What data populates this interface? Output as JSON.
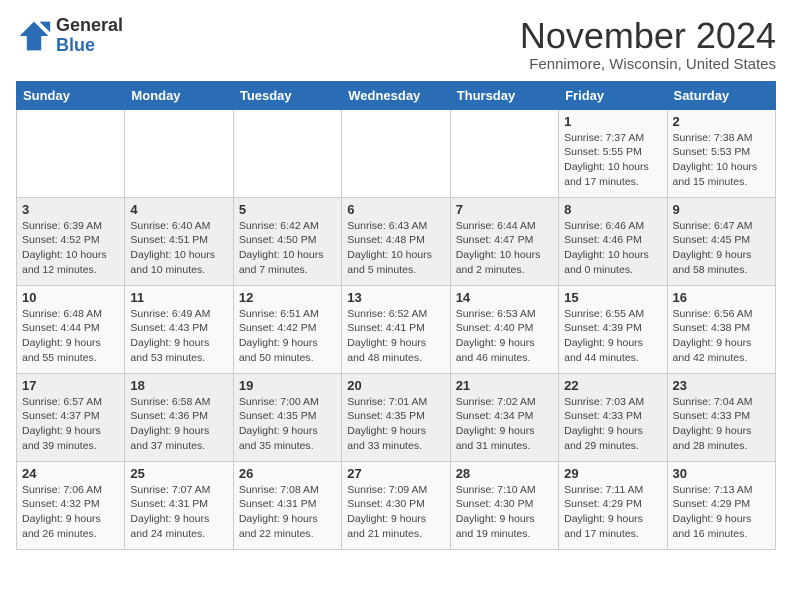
{
  "header": {
    "logo_line1": "General",
    "logo_line2": "Blue",
    "month_year": "November 2024",
    "location": "Fennimore, Wisconsin, United States"
  },
  "weekdays": [
    "Sunday",
    "Monday",
    "Tuesday",
    "Wednesday",
    "Thursday",
    "Friday",
    "Saturday"
  ],
  "weeks": [
    [
      {
        "day": "",
        "detail": ""
      },
      {
        "day": "",
        "detail": ""
      },
      {
        "day": "",
        "detail": ""
      },
      {
        "day": "",
        "detail": ""
      },
      {
        "day": "",
        "detail": ""
      },
      {
        "day": "1",
        "detail": "Sunrise: 7:37 AM\nSunset: 5:55 PM\nDaylight: 10 hours and 17 minutes."
      },
      {
        "day": "2",
        "detail": "Sunrise: 7:38 AM\nSunset: 5:53 PM\nDaylight: 10 hours and 15 minutes."
      }
    ],
    [
      {
        "day": "3",
        "detail": "Sunrise: 6:39 AM\nSunset: 4:52 PM\nDaylight: 10 hours and 12 minutes."
      },
      {
        "day": "4",
        "detail": "Sunrise: 6:40 AM\nSunset: 4:51 PM\nDaylight: 10 hours and 10 minutes."
      },
      {
        "day": "5",
        "detail": "Sunrise: 6:42 AM\nSunset: 4:50 PM\nDaylight: 10 hours and 7 minutes."
      },
      {
        "day": "6",
        "detail": "Sunrise: 6:43 AM\nSunset: 4:48 PM\nDaylight: 10 hours and 5 minutes."
      },
      {
        "day": "7",
        "detail": "Sunrise: 6:44 AM\nSunset: 4:47 PM\nDaylight: 10 hours and 2 minutes."
      },
      {
        "day": "8",
        "detail": "Sunrise: 6:46 AM\nSunset: 4:46 PM\nDaylight: 10 hours and 0 minutes."
      },
      {
        "day": "9",
        "detail": "Sunrise: 6:47 AM\nSunset: 4:45 PM\nDaylight: 9 hours and 58 minutes."
      }
    ],
    [
      {
        "day": "10",
        "detail": "Sunrise: 6:48 AM\nSunset: 4:44 PM\nDaylight: 9 hours and 55 minutes."
      },
      {
        "day": "11",
        "detail": "Sunrise: 6:49 AM\nSunset: 4:43 PM\nDaylight: 9 hours and 53 minutes."
      },
      {
        "day": "12",
        "detail": "Sunrise: 6:51 AM\nSunset: 4:42 PM\nDaylight: 9 hours and 50 minutes."
      },
      {
        "day": "13",
        "detail": "Sunrise: 6:52 AM\nSunset: 4:41 PM\nDaylight: 9 hours and 48 minutes."
      },
      {
        "day": "14",
        "detail": "Sunrise: 6:53 AM\nSunset: 4:40 PM\nDaylight: 9 hours and 46 minutes."
      },
      {
        "day": "15",
        "detail": "Sunrise: 6:55 AM\nSunset: 4:39 PM\nDaylight: 9 hours and 44 minutes."
      },
      {
        "day": "16",
        "detail": "Sunrise: 6:56 AM\nSunset: 4:38 PM\nDaylight: 9 hours and 42 minutes."
      }
    ],
    [
      {
        "day": "17",
        "detail": "Sunrise: 6:57 AM\nSunset: 4:37 PM\nDaylight: 9 hours and 39 minutes."
      },
      {
        "day": "18",
        "detail": "Sunrise: 6:58 AM\nSunset: 4:36 PM\nDaylight: 9 hours and 37 minutes."
      },
      {
        "day": "19",
        "detail": "Sunrise: 7:00 AM\nSunset: 4:35 PM\nDaylight: 9 hours and 35 minutes."
      },
      {
        "day": "20",
        "detail": "Sunrise: 7:01 AM\nSunset: 4:35 PM\nDaylight: 9 hours and 33 minutes."
      },
      {
        "day": "21",
        "detail": "Sunrise: 7:02 AM\nSunset: 4:34 PM\nDaylight: 9 hours and 31 minutes."
      },
      {
        "day": "22",
        "detail": "Sunrise: 7:03 AM\nSunset: 4:33 PM\nDaylight: 9 hours and 29 minutes."
      },
      {
        "day": "23",
        "detail": "Sunrise: 7:04 AM\nSunset: 4:33 PM\nDaylight: 9 hours and 28 minutes."
      }
    ],
    [
      {
        "day": "24",
        "detail": "Sunrise: 7:06 AM\nSunset: 4:32 PM\nDaylight: 9 hours and 26 minutes."
      },
      {
        "day": "25",
        "detail": "Sunrise: 7:07 AM\nSunset: 4:31 PM\nDaylight: 9 hours and 24 minutes."
      },
      {
        "day": "26",
        "detail": "Sunrise: 7:08 AM\nSunset: 4:31 PM\nDaylight: 9 hours and 22 minutes."
      },
      {
        "day": "27",
        "detail": "Sunrise: 7:09 AM\nSunset: 4:30 PM\nDaylight: 9 hours and 21 minutes."
      },
      {
        "day": "28",
        "detail": "Sunrise: 7:10 AM\nSunset: 4:30 PM\nDaylight: 9 hours and 19 minutes."
      },
      {
        "day": "29",
        "detail": "Sunrise: 7:11 AM\nSunset: 4:29 PM\nDaylight: 9 hours and 17 minutes."
      },
      {
        "day": "30",
        "detail": "Sunrise: 7:13 AM\nSunset: 4:29 PM\nDaylight: 9 hours and 16 minutes."
      }
    ]
  ]
}
